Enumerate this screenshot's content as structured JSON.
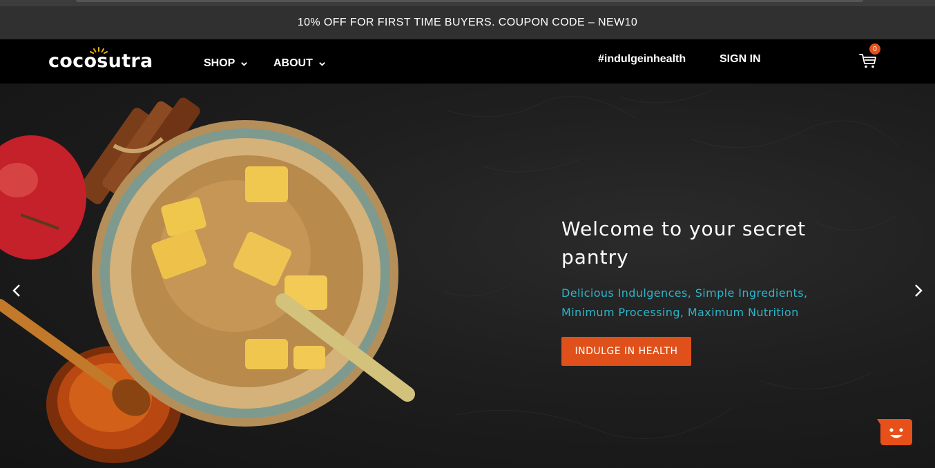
{
  "announcement": {
    "text": "10% OFF FOR FIRST TIME BUYERS. COUPON CODE – NEW10"
  },
  "header": {
    "logo_text": "cocosutra",
    "nav": {
      "shop_label": "SHOP",
      "about_label": "ABOUT",
      "hashtag_label": "#indulgeinhealth",
      "signin_label": "SIGN IN"
    },
    "cart": {
      "count": "0",
      "icon": "cart-icon"
    }
  },
  "hero": {
    "title": "Welcome to your secret pantry",
    "subtitle_line1": "Delicious Indulgences, Simple Ingredients,",
    "subtitle_line2": "Minimum Processing, Maximum Nutrition",
    "cta_label": "INDULGE IN HEALTH",
    "prev_icon": "chevron-left-icon",
    "next_icon": "chevron-right-icon"
  },
  "chat": {
    "icon": "chat-smiley-icon"
  },
  "colors": {
    "accent": "#e0501a",
    "subtitle": "#2cb5c9",
    "announce_bg": "#303030",
    "nav_bg": "#000000"
  }
}
